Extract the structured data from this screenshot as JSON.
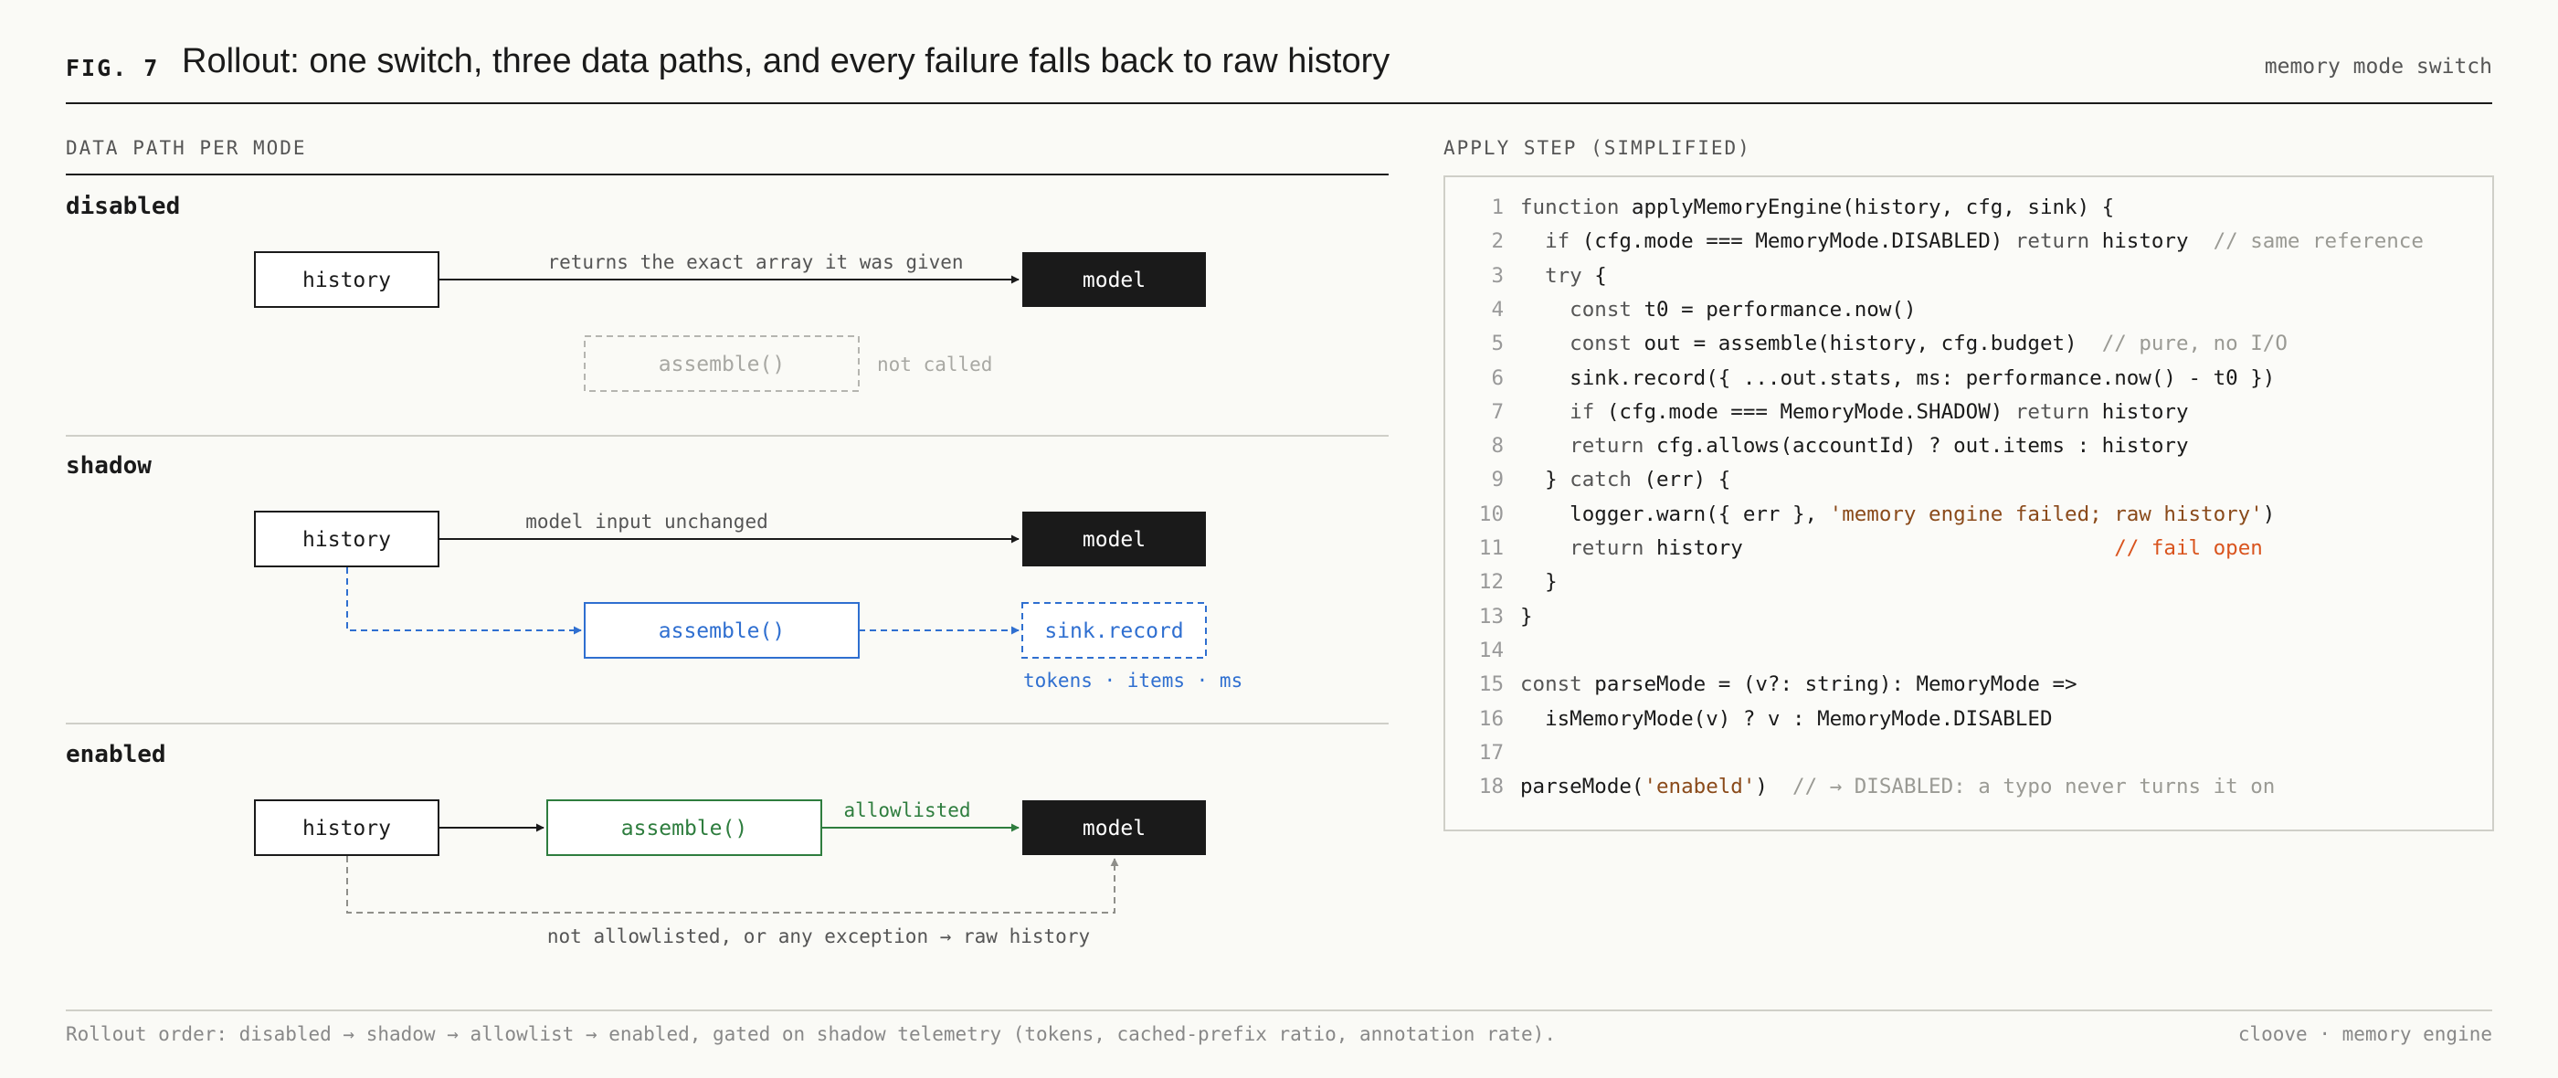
{
  "header": {
    "fig_label": "FIG. 7",
    "title": "Rollout: one switch, three data paths, and every failure falls back to raw history",
    "right_label": "memory mode switch"
  },
  "left_section": {
    "label": "DATA PATH PER MODE"
  },
  "modes": {
    "disabled": {
      "title": "disabled",
      "history_label": "history",
      "model_label": "model",
      "arrow_label": "returns the exact array it was given",
      "assemble_label": "assemble()",
      "assemble_note": "not called"
    },
    "shadow": {
      "title": "shadow",
      "history_label": "history",
      "model_label": "model",
      "arrow_label": "model input unchanged",
      "assemble_label": "assemble()",
      "sink_label": "sink.record",
      "sink_note": "tokens · items · ms"
    },
    "enabled": {
      "title": "enabled",
      "history_label": "history",
      "assemble_label": "assemble()",
      "allow_label": "allowlisted",
      "model_label": "model",
      "fallback_label": "not allowlisted, or any exception → raw history"
    }
  },
  "right_section": {
    "label": "APPLY STEP (SIMPLIFIED)"
  },
  "code_lines": [
    [
      [
        "kw",
        "function "
      ],
      [
        "plain",
        "applyMemoryEngine(history, cfg, sink) {"
      ]
    ],
    [
      [
        "kw",
        "  if "
      ],
      [
        "plain",
        "(cfg.mode === MemoryMode.DISABLED) "
      ],
      [
        "kw",
        "return "
      ],
      [
        "plain",
        "history  "
      ],
      [
        "comment",
        "// same reference"
      ]
    ],
    [
      [
        "kw",
        "  try "
      ],
      [
        "plain",
        "{"
      ]
    ],
    [
      [
        "kw",
        "    const "
      ],
      [
        "plain",
        "t0 = performance.now()"
      ]
    ],
    [
      [
        "kw",
        "    const "
      ],
      [
        "plain",
        "out = assemble(history, cfg.budget)  "
      ],
      [
        "comment",
        "// pure, no I/O"
      ]
    ],
    [
      [
        "plain",
        "    sink.record({ ...out.stats, ms: performance.now() - t0 })"
      ]
    ],
    [
      [
        "kw",
        "    if "
      ],
      [
        "plain",
        "(cfg.mode === MemoryMode.SHADOW) "
      ],
      [
        "kw",
        "return "
      ],
      [
        "plain",
        "history"
      ]
    ],
    [
      [
        "kw",
        "    return "
      ],
      [
        "plain",
        "cfg.allows(accountId) ? out.items : history"
      ]
    ],
    [
      [
        "plain",
        "  } "
      ],
      [
        "kw",
        "catch "
      ],
      [
        "plain",
        "(err) {"
      ]
    ],
    [
      [
        "plain",
        "    logger.warn({ err }, "
      ],
      [
        "string",
        "'memory engine failed; raw history'"
      ],
      [
        "plain",
        ")"
      ]
    ],
    [
      [
        "kw",
        "    return "
      ],
      [
        "plain",
        "history                              "
      ],
      [
        "alert",
        "// fail open"
      ]
    ],
    [
      [
        "plain",
        "  }"
      ]
    ],
    [
      [
        "plain",
        "}"
      ]
    ],
    [],
    [
      [
        "kw",
        "const "
      ],
      [
        "plain",
        "parseMode = (v?: string): MemoryMode =>"
      ]
    ],
    [
      [
        "plain",
        "  isMemoryMode(v) ? v : MemoryMode.DISABLED"
      ]
    ],
    [],
    [
      [
        "plain",
        "parseMode("
      ],
      [
        "string",
        "'enabeld'"
      ],
      [
        "plain",
        ")  "
      ],
      [
        "comment",
        "// → DISABLED: a typo never turns it on"
      ]
    ]
  ],
  "footer": {
    "left": "Rollout order: disabled → shadow → allowlist → enabled, gated on shadow telemetry (tokens, cached-prefix ratio, annotation rate).",
    "right": "cloove · memory engine"
  },
  "colors": {
    "ink": "#1a1a1a",
    "muted": "#555555",
    "dim_dashed": "#b5b5b0",
    "shadow_blue": "#2f6fd0",
    "enabled_green": "#2e7d3e",
    "fallback_gray": "#8f8f8a",
    "alert_orange": "#d9541e",
    "string_brown": "#8a4a1a"
  }
}
